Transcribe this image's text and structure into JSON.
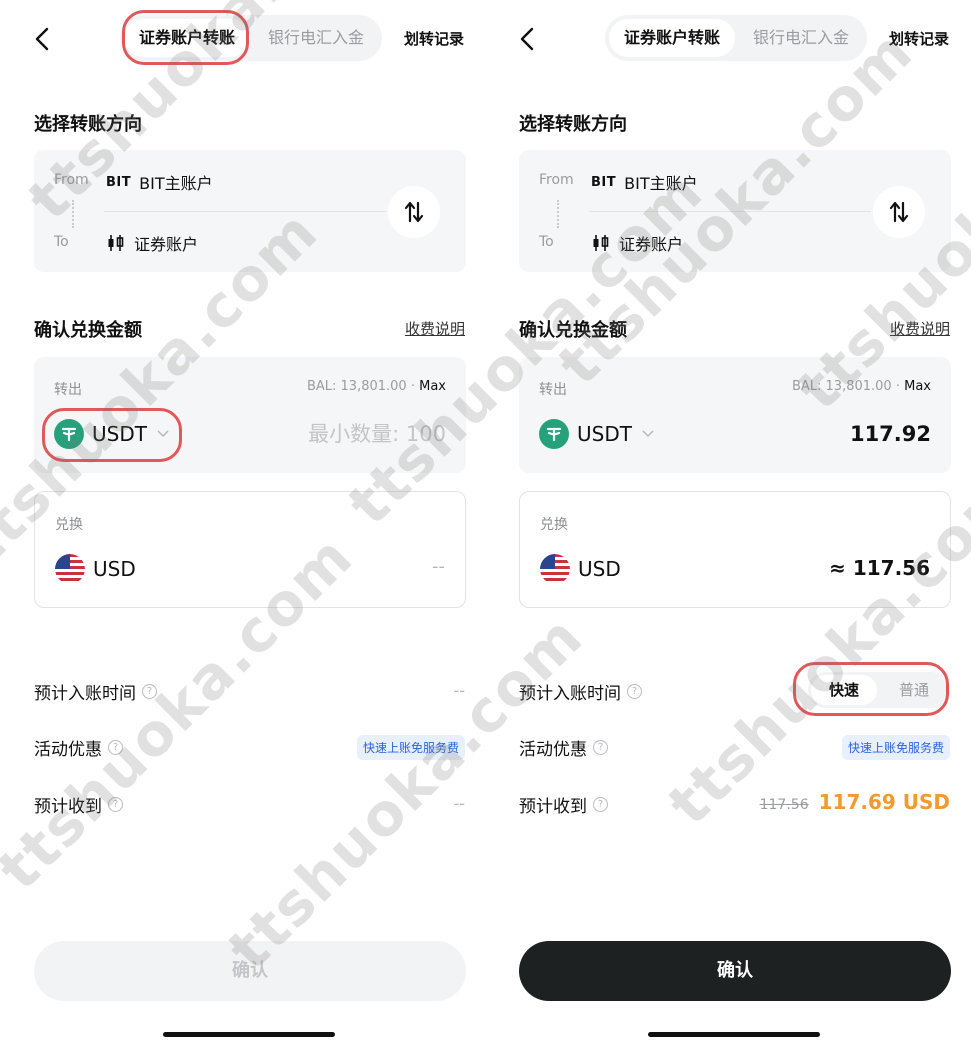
{
  "screens": [
    {
      "header": {
        "tab_active": "证券账户转账",
        "tab_inactive": "银行电汇入金",
        "history": "划转记录"
      },
      "direction": {
        "title": "选择转账方向",
        "from_label": "From",
        "from_logo": "BIT",
        "from_account": "BIT主账户",
        "to_label": "To",
        "to_account": "证券账户"
      },
      "amount": {
        "title": "确认兑换金额",
        "fee_link": "收费说明",
        "out_label": "转出",
        "balance": "BAL: 13,801.00",
        "max": "Max",
        "out_coin": "USDT",
        "out_value": "",
        "out_placeholder": "最小数量: 100",
        "exchange_label": "兑换",
        "ex_coin": "USD",
        "ex_value": "--"
      },
      "info": {
        "eta_label": "预计入账时间",
        "eta_value": "--",
        "promo_label": "活动优惠",
        "promo_badge": "快速上账免服务费",
        "receive_label": "预计收到",
        "receive_value": "--"
      },
      "confirm": "确认",
      "confirm_state": "disabled"
    },
    {
      "header": {
        "tab_active": "证券账户转账",
        "tab_inactive": "银行电汇入金",
        "history": "划转记录"
      },
      "direction": {
        "title": "选择转账方向",
        "from_label": "From",
        "from_logo": "BIT",
        "from_account": "BIT主账户",
        "to_label": "To",
        "to_account": "证券账户"
      },
      "amount": {
        "title": "确认兑换金额",
        "fee_link": "收费说明",
        "out_label": "转出",
        "balance": "BAL: 13,801.00",
        "max": "Max",
        "out_coin": "USDT",
        "out_value": "117.92",
        "out_placeholder": "",
        "exchange_label": "兑换",
        "ex_coin": "USD",
        "ex_value": "≈ 117.56"
      },
      "info": {
        "eta_label": "预计入账时间",
        "speed_fast": "快速",
        "speed_normal": "普通",
        "promo_label": "活动优惠",
        "promo_badge": "快速上账免服务费",
        "receive_label": "预计收到",
        "receive_old": "117.56",
        "receive_new": "117.69 USD"
      },
      "confirm": "确认",
      "confirm_state": "active"
    }
  ],
  "highlight_color": "#e0585a",
  "accent_orange": "#f29a2e",
  "badge_blue": "#2c63d9",
  "usdt_green": "#26a17b",
  "watermark": "ttshuoka.com"
}
